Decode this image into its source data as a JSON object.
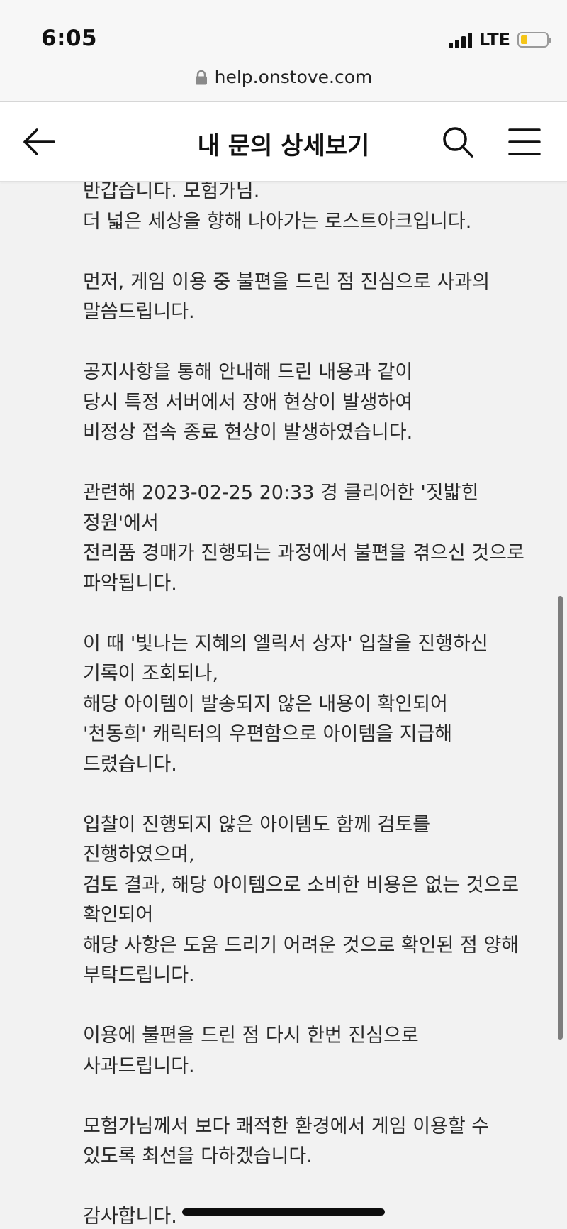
{
  "status_bar": {
    "time": "6:05",
    "network": "LTE",
    "battery_level": 0.25
  },
  "browser": {
    "url": "help.onstove.com"
  },
  "header": {
    "title": "내 문의 상세보기",
    "icons": [
      "back-arrow-icon",
      "search-icon",
      "menu-icon"
    ]
  },
  "message": {
    "text": "반갑습니다. 모험가님.\n더 넓은 세상을 향해 나아가는 로스트아크입니다.\n\n먼저, 게임 이용 중 불편을 드린 점 진심으로 사과의\n말씀드립니다.\n\n공지사항을 통해 안내해 드린 내용과 같이\n당시 특정 서버에서 장애 현상이 발생하여\n비정상 접속 종료 현상이 발생하였습니다.\n\n관련해 2023-02-25 20:33 경 클리어한 '짓밟힌\n정원'에서\n전리품 경매가 진행되는 과정에서 불편을 겪으신 것으로\n파악됩니다.\n\n이 때 '빛나는 지혜의 엘릭서 상자' 입찰을 진행하신\n기록이 조회되나,\n해당 아이템이 발송되지 않은 내용이 확인되어\n'천동희' 캐릭터의 우편함으로 아이템을 지급해\n드렸습니다.\n\n입찰이 진행되지 않은 아이템도 함께 검토를\n진행하였으며,\n검토 결과, 해당 아이템으로 소비한 비용은 없는 것으로\n확인되어\n해당 사항은 도움 드리기 어려운 것으로 확인된 점 양해\n부탁드립니다.\n\n이용에 불편을 드린 점 다시 한번 진심으로\n사과드립니다.\n\n모험가님께서 보다 쾌적한 환경에서 게임 이용할 수\n있도록 최선을 다하겠습니다.\n\n감사합니다."
  },
  "colors": {
    "background": "#f2f2f2",
    "header_bg": "#ffffff",
    "text": "#2a2a2a",
    "battery_fill": "#f5c518"
  }
}
